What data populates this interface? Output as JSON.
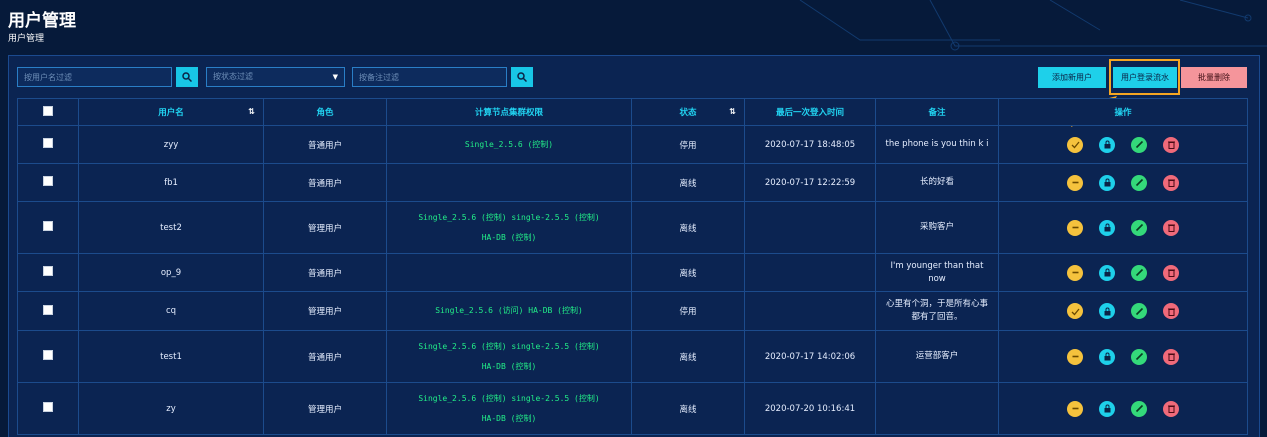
{
  "page": {
    "title": "用户管理",
    "breadcrumb": "用户管理"
  },
  "filters": {
    "username_placeholder": "按用户名过滤",
    "status_placeholder": "按状态过滤",
    "note_placeholder": "按备注过滤"
  },
  "toolbar": {
    "add_label": "添加新用户",
    "log_label": "用户登录流水",
    "batch_delete_label": "批量删除"
  },
  "table": {
    "headers": {
      "username": "用户名",
      "role": "角色",
      "permission": "计算节点集群权限",
      "status": "状态",
      "last_login": "最后一次登入时间",
      "note": "备注",
      "actions": "操作"
    },
    "rows": [
      {
        "username": "zyy",
        "role": "普通用户",
        "perm1": "Single_2.5.6 (控制)",
        "perm2": "",
        "status": "停用",
        "last_login": "2020-07-17 18:48:05",
        "note": "the phone is you thin k i"
      },
      {
        "username": "fb1",
        "role": "普通用户",
        "perm1": "",
        "perm2": "",
        "status": "离线",
        "last_login": "2020-07-17 12:22:59",
        "note": "长的好看"
      },
      {
        "username": "test2",
        "role": "管理用户",
        "perm1": "Single_2.5.6 (控制) single-2.5.5 (控制)",
        "perm2": "HA-DB (控制)",
        "status": "离线",
        "last_login": "",
        "note": "采购客户"
      },
      {
        "username": "op_9",
        "role": "普通用户",
        "perm1": "",
        "perm2": "",
        "status": "离线",
        "last_login": "",
        "note": "I'm younger than that now"
      },
      {
        "username": "cq",
        "role": "管理用户",
        "perm1": "Single_2.5.6 (访问) HA-DB (控制)",
        "perm2": "",
        "status": "停用",
        "last_login": "",
        "note": "心里有个洞，于是所有心事都有了回音。"
      },
      {
        "username": "test1",
        "role": "普通用户",
        "perm1": "Single_2.5.6 (控制) single-2.5.5 (控制)",
        "perm2": "HA-DB (控制)",
        "status": "离线",
        "last_login": "2020-07-17 14:02:06",
        "note": "运营部客户"
      },
      {
        "username": "zy",
        "role": "管理用户",
        "perm1": "Single_2.5.6 (控制) single-2.5.5 (控制)",
        "perm2": "HA-DB (控制)",
        "status": "离线",
        "last_login": "2020-07-20 10:16:41",
        "note": ""
      }
    ]
  },
  "colors": {
    "accent": "#21d4f2",
    "permission": "#22ee88",
    "disabled": "#ff5a6a",
    "highlight": "#f5a623"
  },
  "icons": [
    "search-icon",
    "caret-down-icon",
    "sort-icon",
    "check-icon",
    "minus-icon",
    "lock-icon",
    "edit-icon",
    "trash-icon",
    "arrow-annotation"
  ]
}
